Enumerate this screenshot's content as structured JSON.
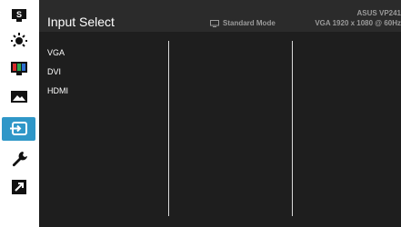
{
  "sidebar": {
    "items": [
      {
        "icon": "splendid-icon",
        "label": "S"
      },
      {
        "icon": "blue-light-filter-icon"
      },
      {
        "icon": "color-icon"
      },
      {
        "icon": "image-icon"
      },
      {
        "icon": "input-select-icon",
        "active": true
      },
      {
        "icon": "system-setup-icon"
      },
      {
        "icon": "shortcut-icon"
      }
    ]
  },
  "header": {
    "title": "Input Select",
    "mode": "Standard Mode",
    "model": "ASUS VP241",
    "signal": "VGA 1920 x 1080 @ 60Hz"
  },
  "menu": {
    "options": [
      "VGA",
      "DVI",
      "HDMI"
    ]
  },
  "colors": {
    "panel_bg": "#1e1e1e",
    "header_bg": "#2b2b2b",
    "active_highlight": "#2f97c8",
    "text": "#ffffff",
    "muted_text": "#9a9a9a"
  }
}
